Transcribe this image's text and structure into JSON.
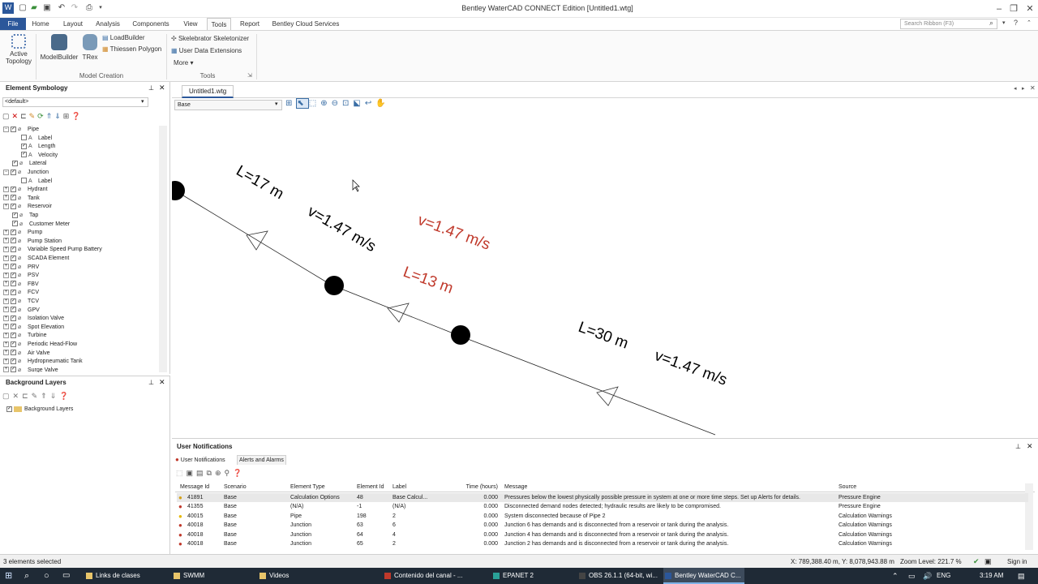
{
  "title": "Bentley WaterCAD CONNECT Edition [Untitled1.wtg]",
  "ribbon_tabs": [
    "File",
    "Home",
    "Layout",
    "Analysis",
    "Components",
    "View",
    "Tools",
    "Report",
    "Bentley Cloud Services"
  ],
  "search_placeholder": "Search Ribbon (F3)",
  "ribbon": {
    "active_topology_1": "Active",
    "active_topology_2": "Topology",
    "modelbuilder": "ModelBuilder",
    "trex": "TRex",
    "loadbuilder": "LoadBuilder",
    "thiessen": "Thiessen Polygon",
    "group_model_creation": "Model Creation",
    "skelebrator": "Skelebrator Skeletonizer",
    "user_data": "User Data Extensions",
    "more": "More",
    "group_tools": "Tools"
  },
  "element_symbology": {
    "title": "Element Symbology",
    "dropdown": "<default>",
    "items": [
      {
        "label": "Pipe",
        "level": 0,
        "checked": true,
        "expander": "minus"
      },
      {
        "label": "Label",
        "level": 1,
        "checked": false
      },
      {
        "label": "Length",
        "level": 1,
        "checked": true
      },
      {
        "label": "Velocity",
        "level": 1,
        "checked": true
      },
      {
        "label": "Lateral",
        "level": 0,
        "checked": true
      },
      {
        "label": "Junction",
        "level": 0,
        "checked": true,
        "expander": "minus"
      },
      {
        "label": "Label",
        "level": 1,
        "checked": false
      },
      {
        "label": "Hydrant",
        "level": 0,
        "checked": true,
        "expander": "plus"
      },
      {
        "label": "Tank",
        "level": 0,
        "checked": true,
        "expander": "plus"
      },
      {
        "label": "Reservoir",
        "level": 0,
        "checked": true,
        "expander": "plus"
      },
      {
        "label": "Tap",
        "level": 0,
        "checked": true
      },
      {
        "label": "Customer Meter",
        "level": 0,
        "checked": true
      },
      {
        "label": "Pump",
        "level": 0,
        "checked": true,
        "expander": "plus"
      },
      {
        "label": "Pump Station",
        "level": 0,
        "checked": true,
        "expander": "plus"
      },
      {
        "label": "Variable Speed Pump Battery",
        "level": 0,
        "checked": true,
        "expander": "plus"
      },
      {
        "label": "SCADA Element",
        "level": 0,
        "checked": true,
        "expander": "plus"
      },
      {
        "label": "PRV",
        "level": 0,
        "checked": true,
        "expander": "plus"
      },
      {
        "label": "PSV",
        "level": 0,
        "checked": true,
        "expander": "plus"
      },
      {
        "label": "FBV",
        "level": 0,
        "checked": true,
        "expander": "plus"
      },
      {
        "label": "FCV",
        "level": 0,
        "checked": true,
        "expander": "plus"
      },
      {
        "label": "TCV",
        "level": 0,
        "checked": true,
        "expander": "plus"
      },
      {
        "label": "GPV",
        "level": 0,
        "checked": true,
        "expander": "plus"
      },
      {
        "label": "Isolation Valve",
        "level": 0,
        "checked": true,
        "expander": "plus"
      },
      {
        "label": "Spot Elevation",
        "level": 0,
        "checked": true,
        "expander": "plus"
      },
      {
        "label": "Turbine",
        "level": 0,
        "checked": true,
        "expander": "plus"
      },
      {
        "label": "Periodic Head-Flow",
        "level": 0,
        "checked": true,
        "expander": "plus"
      },
      {
        "label": "Air Valve",
        "level": 0,
        "checked": true,
        "expander": "plus"
      },
      {
        "label": "Hydropneumatic Tank",
        "level": 0,
        "checked": true,
        "expander": "plus"
      },
      {
        "label": "Surge Valve",
        "level": 0,
        "checked": true,
        "expander": "plus"
      }
    ]
  },
  "background_layers": {
    "title": "Background Layers",
    "item": "Background Layers"
  },
  "document_tab": "Untitled1.wtg",
  "scenario": "Base",
  "canvas_labels": {
    "l1": "L=17 m",
    "v1": "v=1.47 m/s",
    "l2": "L=13 m",
    "v2": "v=1.47 m/s",
    "l3": "L=30 m",
    "v3": "v=1.47 m/s"
  },
  "notifications": {
    "title": "User Notifications",
    "tab_user": "User Notifications",
    "tab_alerts": "Alerts and Alarms",
    "headers": [
      "Message Id",
      "Scenario",
      "Element Type",
      "Element Id",
      "Label",
      "Time (hours)",
      "Message",
      "Source"
    ],
    "rows": [
      {
        "icon": "info",
        "id": "41891",
        "scenario": "Base",
        "type": "Calculation Options",
        "eid": "48",
        "label": "Base Calcul...",
        "time": "0.000",
        "message": "Pressures below the lowest physically possible pressure in system at one or more time steps. Set up Alerts for details.",
        "source": "Pressure Engine"
      },
      {
        "icon": "error",
        "id": "41355",
        "scenario": "Base",
        "type": "(N/A)",
        "eid": "-1",
        "label": "(N/A)",
        "time": "0.000",
        "message": "Disconnected demand nodes detected; hydraulic results are likely to be compromised.",
        "source": "Pressure Engine"
      },
      {
        "icon": "warn",
        "id": "40015",
        "scenario": "Base",
        "type": "Pipe",
        "eid": "198",
        "label": "2",
        "time": "0.000",
        "message": "System disconnected because of Pipe 2",
        "source": "Calculation Warnings"
      },
      {
        "icon": "error",
        "id": "40018",
        "scenario": "Base",
        "type": "Junction",
        "eid": "63",
        "label": "6",
        "time": "0.000",
        "message": "Junction 6 has demands and is disconnected from a reservoir or tank during the analysis.",
        "source": "Calculation Warnings"
      },
      {
        "icon": "error",
        "id": "40018",
        "scenario": "Base",
        "type": "Junction",
        "eid": "64",
        "label": "4",
        "time": "0.000",
        "message": "Junction 4 has demands and is disconnected from a reservoir or tank during the analysis.",
        "source": "Calculation Warnings"
      },
      {
        "icon": "error",
        "id": "40018",
        "scenario": "Base",
        "type": "Junction",
        "eid": "65",
        "label": "2",
        "time": "0.000",
        "message": "Junction 2 has demands and is disconnected from a reservoir or tank during the analysis.",
        "source": "Calculation Warnings"
      }
    ]
  },
  "status": {
    "left": "3 elements selected",
    "coords": "X: 789,388.40 m, Y: 8,078,943.88 m",
    "zoom": "Zoom Level: 221.7 %",
    "sign_in": "Sign in"
  },
  "taskbar": {
    "apps": [
      "Links de clases",
      "SWMM",
      "Videos",
      "Contenido del canal - ...",
      "EPANET 2",
      "OBS 26.1.1 (64-bit, wi...",
      "Bentley WaterCAD C..."
    ],
    "lang": "ENG",
    "time": "3:19 AM"
  },
  "colors": {
    "accent": "#2b579a",
    "error": "#c0392b",
    "warn": "#e6b800",
    "label_red": "#c0392b"
  }
}
